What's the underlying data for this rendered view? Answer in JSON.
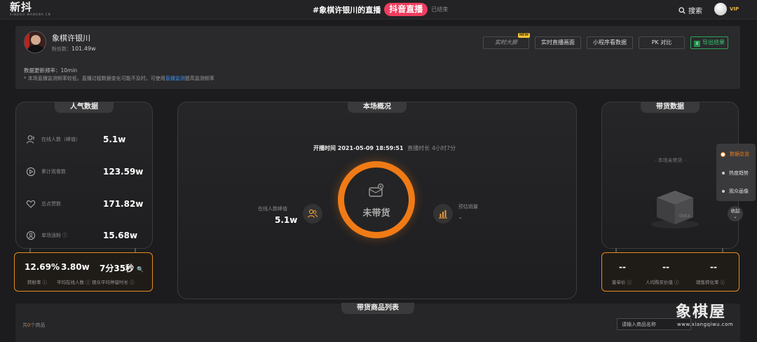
{
  "app": {
    "logo": "新抖",
    "logo_sub": "XINDOU.WANGNA.CN",
    "live_title": "#象棋许银川的直播",
    "live_badge": "抖音直播",
    "live_status": "已结束",
    "search_label": "搜索",
    "vip_label": "VIP"
  },
  "anchor": {
    "name": "象棋许银川",
    "fans_label": "粉丝数：",
    "fans_value": "101.49w",
    "update_freq": "数据更新频率：10min",
    "note_prefix": "* 本场直播监测频率较低，直播过程数据变化可能不及时，可使用",
    "note_link": "直播监测",
    "note_suffix": "提高监测频率"
  },
  "actions": {
    "realtime_big": "实时大屏",
    "new_tag": "NEW",
    "realtime_screen": "实时直播画面",
    "mini_program": "小程序看数据",
    "pk": "PK 对比",
    "export": "导出结果"
  },
  "popularity": {
    "title": "人气数据",
    "metrics": [
      {
        "label": "在线人数（峰值）",
        "value": "5.1w",
        "icon": "user-icon"
      },
      {
        "label": "累计观看数",
        "value": "123.59w",
        "icon": "play-circle-icon"
      },
      {
        "label": "总点赞数",
        "value": "171.82w",
        "icon": "heart-icon"
      },
      {
        "label": "单场涨粉",
        "value": "15.68w",
        "icon": "user-plus-icon"
      }
    ],
    "sub": [
      {
        "value": "12.69%",
        "label": "转粉率"
      },
      {
        "value": "3.80w",
        "label": "平均在线人数"
      },
      {
        "value": "7分35秒",
        "label": "观众平均停留时长"
      }
    ]
  },
  "overview": {
    "title": "本场概况",
    "start_label": "开播时间",
    "start_time": "2021-05-09 18:59:51",
    "duration_label": "直播时长",
    "duration": "4小时7分",
    "ring_text": "未带货",
    "peak_label": "在线人数峰值",
    "peak_value": "5.1w",
    "sales_label": "预估销量",
    "sales_value": "-"
  },
  "goods_data": {
    "title": "带货数据",
    "empty_text": "· 本场未带货 ·",
    "box_label": "data",
    "sub": [
      {
        "value": "--",
        "label": "客单价"
      },
      {
        "value": "--",
        "label": "人均购买价值"
      },
      {
        "value": "--",
        "label": "销售转化率"
      }
    ]
  },
  "side_nav": {
    "items": [
      "数据总览",
      "热度趋势",
      "观众画像"
    ],
    "active": 0,
    "collapse": "收起"
  },
  "goods_list": {
    "title": "带货商品列表",
    "count_prefix": "共",
    "count": "0",
    "count_suffix": "个商品",
    "search_placeholder": "请输入商品名称"
  },
  "watermark": {
    "main": "象棋屋",
    "sub": "www.xiangqiwu.com"
  },
  "colors": {
    "accent": "#f07b16",
    "live_badge": "#ef3d5e",
    "link": "#3b8ff0",
    "export": "#38c172"
  }
}
